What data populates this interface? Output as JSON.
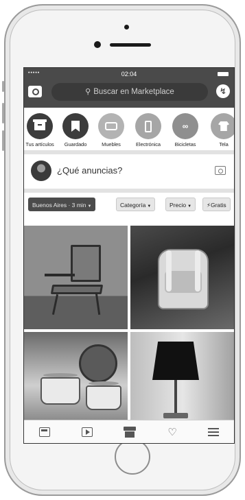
{
  "status_bar": {
    "time": "02:04",
    "signal": "•••••"
  },
  "search": {
    "placeholder": "Buscar en Marketplace"
  },
  "categories": [
    {
      "label": "Tus artículos",
      "icon": "box-icon",
      "color": "#3c3c3c"
    },
    {
      "label": "Guardado",
      "icon": "bookmark-icon",
      "color": "#3c3c3c"
    },
    {
      "label": "Muebles",
      "icon": "sofa-icon",
      "color": "#b3b3b3"
    },
    {
      "label": "Electrónica",
      "icon": "phone-icon",
      "color": "#a6a6a6"
    },
    {
      "label": "Bicicletas",
      "icon": "bike-icon",
      "color": "#8f8f8f"
    },
    {
      "label": "Tela",
      "icon": "shirt-icon",
      "color": "#a6a6a6"
    }
  ],
  "composer": {
    "prompt": "¿Qué anuncias?"
  },
  "filters": [
    {
      "label": "Buenos Aires · 3 min",
      "active": true
    },
    {
      "label": "Categoría",
      "active": false
    },
    {
      "label": "Precio",
      "active": false
    },
    {
      "label": "Gratis",
      "active": false
    }
  ],
  "listings": [
    {
      "subject": "armchair"
    },
    {
      "subject": "backpack"
    },
    {
      "subject": "cooking pots"
    },
    {
      "subject": "table lamp"
    }
  ],
  "tabbar": {
    "items": [
      "news-feed-icon",
      "video-icon",
      "marketplace-icon",
      "notifications-icon",
      "menu-icon"
    ]
  },
  "colors": {
    "topbar": "#4a4a4a",
    "divider": "#e2e2e2",
    "active_chip": "#4b4b4b"
  }
}
